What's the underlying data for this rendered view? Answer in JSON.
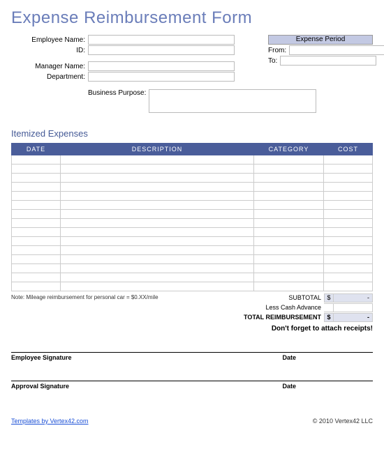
{
  "title": "Expense Reimbursement Form",
  "fields": {
    "employee_name_label": "Employee Name:",
    "employee_name_value": "",
    "id_label": "ID:",
    "id_value": "",
    "manager_name_label": "Manager Name:",
    "manager_name_value": "",
    "department_label": "Department:",
    "department_value": "",
    "purpose_label": "Business Purpose:",
    "purpose_value": ""
  },
  "period": {
    "header": "Expense Period",
    "from_label": "From:",
    "from_value": "",
    "to_label": "To:",
    "to_value": ""
  },
  "section_itemized": "Itemized Expenses",
  "table": {
    "headers": {
      "date": "DATE",
      "description": "DESCRIPTION",
      "category": "CATEGORY",
      "cost": "COST"
    },
    "rows": [
      {
        "date": "",
        "description": "",
        "category": "",
        "cost": ""
      },
      {
        "date": "",
        "description": "",
        "category": "",
        "cost": ""
      },
      {
        "date": "",
        "description": "",
        "category": "",
        "cost": ""
      },
      {
        "date": "",
        "description": "",
        "category": "",
        "cost": ""
      },
      {
        "date": "",
        "description": "",
        "category": "",
        "cost": ""
      },
      {
        "date": "",
        "description": "",
        "category": "",
        "cost": ""
      },
      {
        "date": "",
        "description": "",
        "category": "",
        "cost": ""
      },
      {
        "date": "",
        "description": "",
        "category": "",
        "cost": ""
      },
      {
        "date": "",
        "description": "",
        "category": "",
        "cost": ""
      },
      {
        "date": "",
        "description": "",
        "category": "",
        "cost": ""
      },
      {
        "date": "",
        "description": "",
        "category": "",
        "cost": ""
      },
      {
        "date": "",
        "description": "",
        "category": "",
        "cost": ""
      },
      {
        "date": "",
        "description": "",
        "category": "",
        "cost": ""
      },
      {
        "date": "",
        "description": "",
        "category": "",
        "cost": ""
      },
      {
        "date": "",
        "description": "",
        "category": "",
        "cost": ""
      }
    ]
  },
  "note": "Note: Mileage reimbursement for personal car = $0.XX/mile",
  "totals": {
    "subtotal_label": "SUBTOTAL",
    "subtotal_currency": "$",
    "subtotal_value": "-",
    "less_label": "Less Cash Advance",
    "less_value": "",
    "total_label": "TOTAL REIMBURSEMENT",
    "total_currency": "$",
    "total_value": "-"
  },
  "reminder": "Don't forget to attach receipts!",
  "signatures": {
    "employee_label": "Employee Signature",
    "approval_label": "Approval Signature",
    "date_label": "Date"
  },
  "footer": {
    "link_text": "Templates by Vertex42.com",
    "copyright": "© 2010 Vertex42 LLC"
  }
}
